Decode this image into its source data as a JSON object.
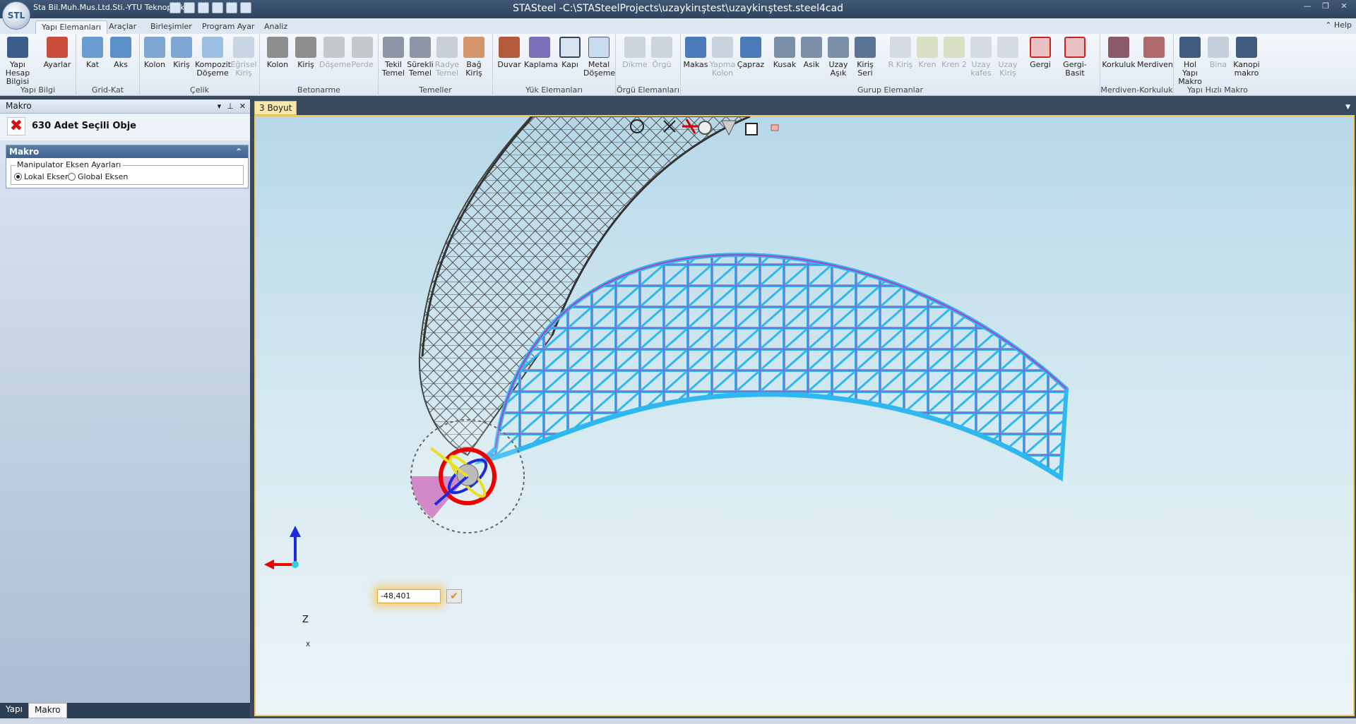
{
  "titlebar": {
    "company": "Sta Bil.Muh.Mus.Ltd.Sti.-YTU Teknopark",
    "title": "STASteel -C:\\STASteelProjects\\uzaykirιştest\\uzaykirιştest.steel4cad",
    "app_logo": "STL"
  },
  "tabs": [
    "Yapı Elemanları",
    "Araçlar",
    "Birleşimler",
    "Program Ayar",
    "Analiz"
  ],
  "help": "Help",
  "ribbon": {
    "yapi_bilgi": {
      "label": "Yapı Bilgi",
      "b1": "Yapı Hesap Bilgisi",
      "b2": "Ayarlar"
    },
    "grid_kat": {
      "label": "Grid-Kat",
      "b1": "Kat",
      "b2": "Aks"
    },
    "celik": {
      "label": "Çelik",
      "b1": "Kolon",
      "b2": "Kiriş",
      "b3": "Kompozit Döşeme",
      "b4": "Eğrisel Kiriş"
    },
    "betonarme": {
      "label": "Betonarme",
      "b1": "Kolon",
      "b2": "Kiriş",
      "b3": "Döşeme",
      "b4": "Perde"
    },
    "temeller": {
      "label": "Temeller",
      "b1": "Tekil Temel",
      "b2": "Sürekli Temel",
      "b3": "Radye Temel",
      "b4": "Bağ Kiriş"
    },
    "yuk": {
      "label": "Yük Elemanları",
      "b1": "Duvar",
      "b2": "Kaplama",
      "b3": "Kapı",
      "b4": "Metal Döşeme"
    },
    "orgu": {
      "label": "Örgü Elemanları",
      "b1": "Dikme",
      "b2": "Örgü"
    },
    "gurup": {
      "label": "Gurup Elemanlar",
      "b1": "Makas",
      "b2": "Yapma Kolon",
      "b3": "Çapraz",
      "b4": "Kusak",
      "b5": "Asik",
      "b6": "Uzay Aşık",
      "b7": "Kiriş Seri",
      "b8": "R Kiriş",
      "b9": "Kren",
      "b10": "Kren 2",
      "b11": "Uzay kafes",
      "b12": "Uzay Kiriş",
      "b13": "Gergi",
      "b14": "Gergi-Basit"
    },
    "merdiven": {
      "label": "Merdiven-Korkuluk",
      "b1": "Korkuluk",
      "b2": "Merdiven"
    },
    "hizli": {
      "label": "Yapı Hızlı Makro",
      "b1": "Hol Yapı Makro",
      "b2": "Bina",
      "b3": "Kanopi makro"
    }
  },
  "left_panel": {
    "title": "Makro",
    "selection": "630 Adet Seçili Obje",
    "section": "Makro",
    "group_label": "Manipulator Eksen Ayarları",
    "radio_local": "Lokal Eksen",
    "radio_global": "Global Eksen",
    "selected_axis": "Lokal Eksen",
    "bottom_tabs": [
      "Yapı",
      "Makro"
    ]
  },
  "viewport": {
    "tab": "3 Boyut",
    "input_value": "-48,401",
    "axis_z": "Z",
    "axis_x": "X"
  },
  "colors": {
    "selected_structure": "#2fb8f0",
    "selected_edge": "#b040c0",
    "unselected": "#555555"
  }
}
